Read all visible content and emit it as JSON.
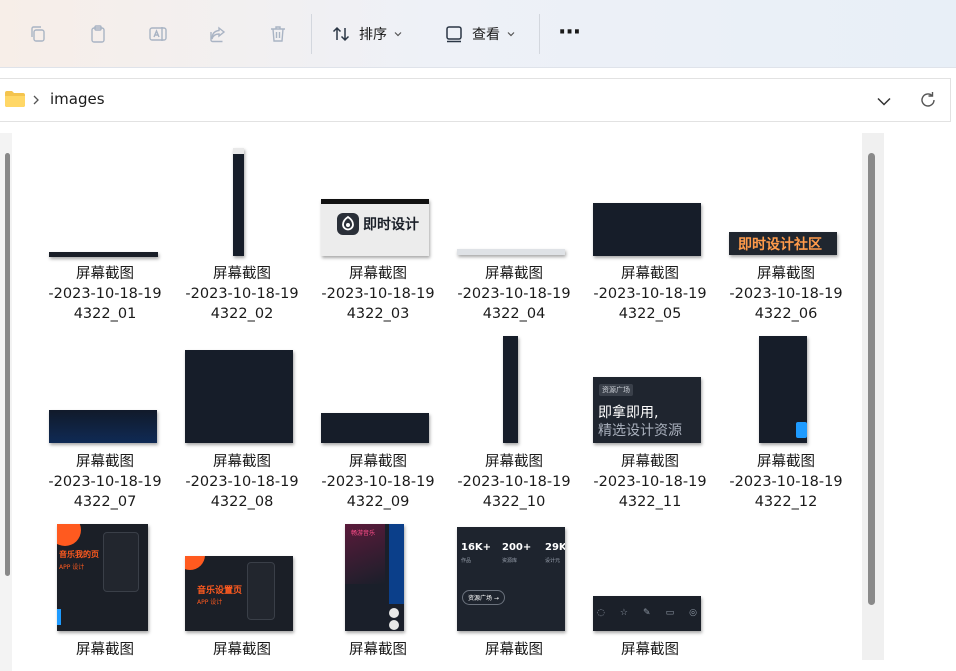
{
  "toolbar": {
    "sort_label": "排序",
    "view_label": "查看",
    "more_label": "···"
  },
  "address": {
    "folder": "images"
  },
  "files": [
    {
      "l1": "屏幕截图",
      "l2": "-2023-10-18-19",
      "l3": "4322_01"
    },
    {
      "l1": "屏幕截图",
      "l2": "-2023-10-18-19",
      "l3": "4322_02"
    },
    {
      "l1": "屏幕截图",
      "l2": "-2023-10-18-19",
      "l3": "4322_03",
      "thumb_text": "即时设计"
    },
    {
      "l1": "屏幕截图",
      "l2": "-2023-10-18-19",
      "l3": "4322_04"
    },
    {
      "l1": "屏幕截图",
      "l2": "-2023-10-18-19",
      "l3": "4322_05"
    },
    {
      "l1": "屏幕截图",
      "l2": "-2023-10-18-19",
      "l3": "4322_06",
      "thumb_text": "即时设计社区"
    },
    {
      "l1": "屏幕截图",
      "l2": "-2023-10-18-19",
      "l3": "4322_07"
    },
    {
      "l1": "屏幕截图",
      "l2": "-2023-10-18-19",
      "l3": "4322_08"
    },
    {
      "l1": "屏幕截图",
      "l2": "-2023-10-18-19",
      "l3": "4322_09"
    },
    {
      "l1": "屏幕截图",
      "l2": "-2023-10-18-19",
      "l3": "4322_10"
    },
    {
      "l1": "屏幕截图",
      "l2": "-2023-10-18-19",
      "l3": "4322_11",
      "thumb_tag": "资源广场",
      "thumb_line1": "即拿即用,",
      "thumb_line2": "精选设计资源"
    },
    {
      "l1": "屏幕截图",
      "l2": "-2023-10-18-19",
      "l3": "4322_12"
    },
    {
      "l1": "屏幕截图",
      "thumb_text": "音乐我的页",
      "thumb_sub": "APP 设计"
    },
    {
      "l1": "屏幕截图",
      "thumb_text": "音乐设置页",
      "thumb_sub": "APP 设计"
    },
    {
      "l1": "屏幕截图",
      "thumb_text": "畅游音乐"
    },
    {
      "l1": "屏幕截图",
      "stat1": "16K+",
      "stat1_sub": "作品",
      "stat2": "200+",
      "stat2_sub": "资源库",
      "stat3": "29K",
      "stat3_sub": "设计元",
      "btn": "资源广场 →"
    },
    {
      "l1": "屏幕截图"
    }
  ],
  "colors": {
    "thumb_bg": "#161d29",
    "accent_orange": "#ff5a1f",
    "accent_blue": "#1e9bff"
  }
}
